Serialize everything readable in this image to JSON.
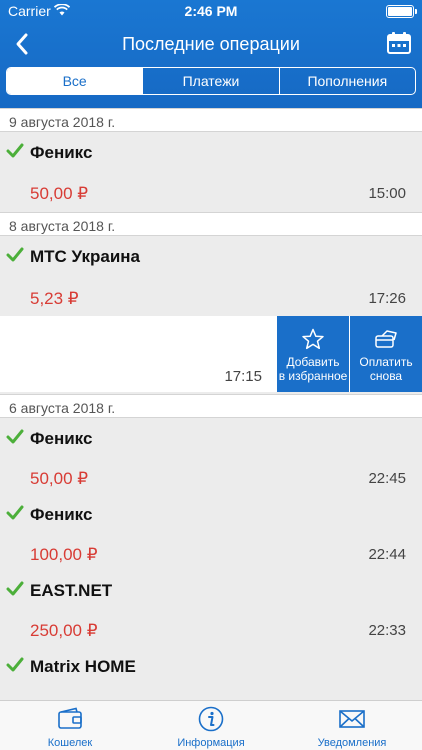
{
  "status": {
    "carrier": "Carrier",
    "time": "2:46 PM"
  },
  "nav": {
    "title": "Последние операции"
  },
  "segments": [
    "Все",
    "Платежи",
    "Пополнения"
  ],
  "groups": [
    {
      "date": "9 августа 2018 г."
    },
    {
      "date": "8 августа 2018 г."
    },
    {
      "date": "6 августа 2018 г."
    }
  ],
  "transactions": [
    {
      "name": "Феникс",
      "amount": "50,00 ₽",
      "time": "15:00"
    },
    {
      "name": "МТС Украина",
      "amount": "5,23 ₽",
      "time": "17:26"
    },
    {
      "name": "Феникс",
      "amount": "50,00 ₽",
      "time": "22:45"
    },
    {
      "name": "Феникс",
      "amount": "100,00 ₽",
      "time": "22:44"
    },
    {
      "name": "EAST.NET",
      "amount": "250,00 ₽",
      "time": "22:33"
    },
    {
      "name": "Matrix HOME",
      "amount": "",
      "time": ""
    }
  ],
  "swiped_row": {
    "time": "17:15",
    "actions": {
      "favorite_line1": "Добавить",
      "favorite_line2": "в избранное",
      "repay_line1": "Оплатить",
      "repay_line2": "снова"
    }
  },
  "tabbar": {
    "wallet": "Кошелек",
    "info": "Информация",
    "notifications": "Уведомления"
  },
  "colors": {
    "accent": "#1a6fc9",
    "amount": "#d83c35",
    "check": "#4caf3a"
  },
  "icons": [
    "back-chevron-icon",
    "calendar-icon",
    "check-icon",
    "star-icon",
    "payment-card-icon",
    "wallet-icon",
    "info-icon",
    "envelope-icon"
  ]
}
